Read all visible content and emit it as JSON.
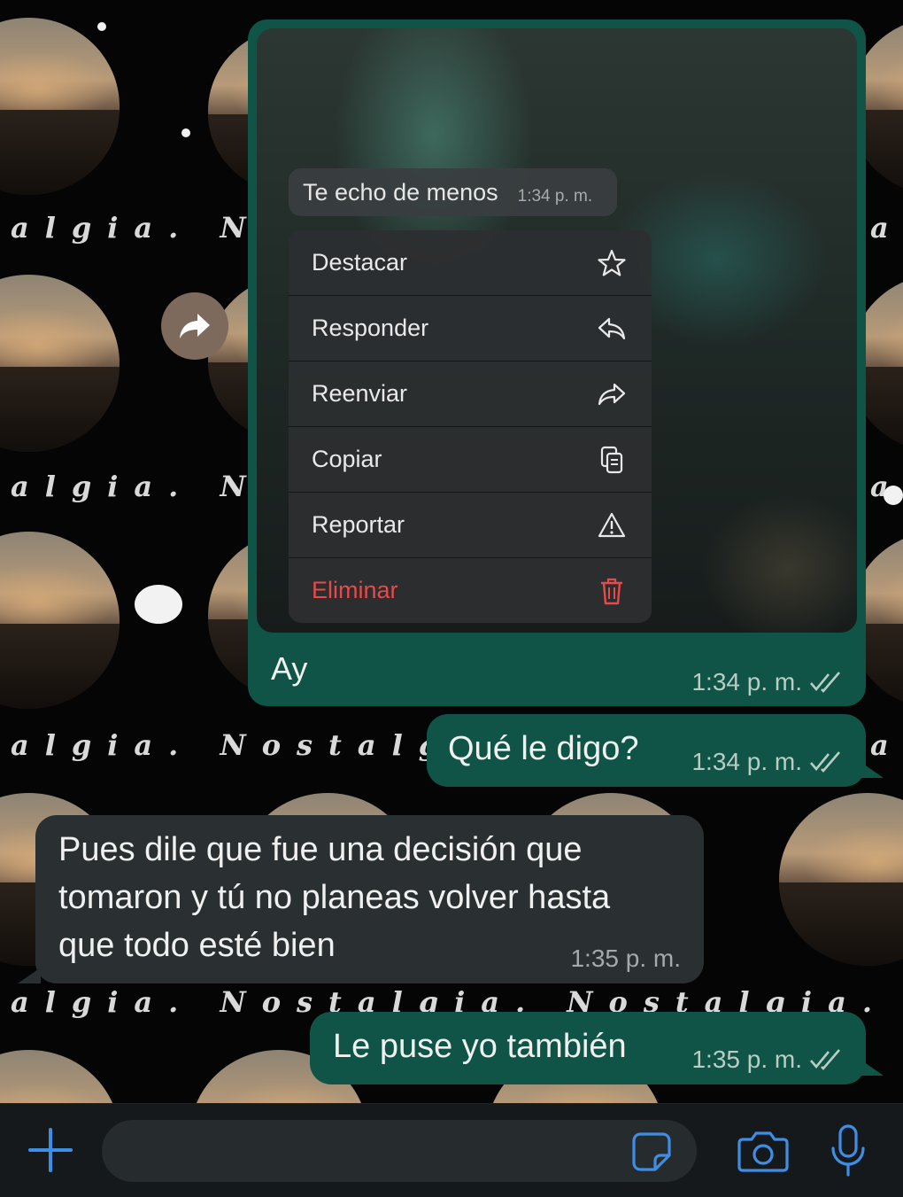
{
  "wallpaper": {
    "text_rows": [
      "algia. No",
      "algia. No",
      "algia. Nostalgia",
      "algia. Nostalgia. Nostalgia. Nosta"
    ],
    "right_letter": "a"
  },
  "context_menu": {
    "quoted_message": {
      "text": "Te echo de menos",
      "time": "1:34 p. m."
    },
    "items": [
      {
        "label": "Destacar",
        "icon": "star-icon"
      },
      {
        "label": "Responder",
        "icon": "reply-icon"
      },
      {
        "label": "Reenviar",
        "icon": "forward-icon"
      },
      {
        "label": "Copiar",
        "icon": "copy-icon"
      },
      {
        "label": "Reportar",
        "icon": "warning-icon"
      },
      {
        "label": "Eliminar",
        "icon": "trash-icon"
      }
    ]
  },
  "messages": [
    {
      "direction": "out",
      "text": "Ay",
      "time": "1:34 p. m.",
      "status": "read"
    },
    {
      "direction": "out",
      "text": "Qué le digo?",
      "time": "1:34 p. m.",
      "status": "read"
    },
    {
      "direction": "in",
      "lines": [
        "Pues dile que fue una decisión que",
        "tomaron y tú no planeas volver hasta",
        "que todo esté bien"
      ],
      "time": "1:35 p. m."
    },
    {
      "direction": "out",
      "text": "Le puse yo también",
      "time": "1:35 p. m.",
      "status": "read"
    }
  ],
  "input_bar": {
    "icons": [
      "plus-icon",
      "sticker-icon",
      "camera-icon",
      "microphone-icon"
    ]
  },
  "colors": {
    "outgoing_bubble": "#0f5446",
    "incoming_bubble": "#2a2f31",
    "accent_blue": "#3e8ee6",
    "danger_red": "#e64a4a"
  }
}
